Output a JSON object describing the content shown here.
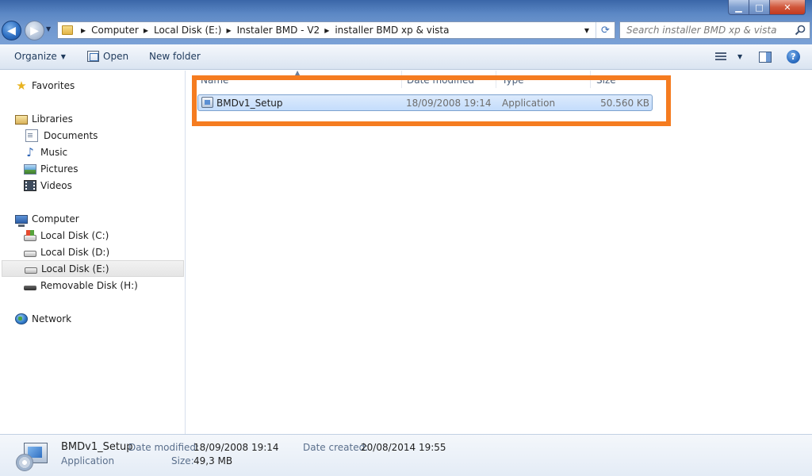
{
  "window": {
    "minimize_glyph": "▁",
    "maximize_glyph": "□",
    "close_glyph": "✕"
  },
  "address": {
    "crumbs": [
      "Computer",
      "Local Disk (E:)",
      "Instaler BMD - V2",
      "installer BMD xp & vista"
    ]
  },
  "search": {
    "placeholder": "Search installer BMD xp & vista"
  },
  "toolbar": {
    "organize_label": "Organize",
    "open_label": "Open",
    "new_folder_label": "New folder",
    "help_glyph": "?"
  },
  "nav": {
    "favorites": "Favorites",
    "libraries": "Libraries",
    "documents": "Documents",
    "music": "Music",
    "pictures": "Pictures",
    "videos": "Videos",
    "computer": "Computer",
    "disk_c": "Local Disk (C:)",
    "disk_d": "Local Disk (D:)",
    "disk_e": "Local Disk (E:)",
    "disk_h": "Removable Disk (H:)",
    "network": "Network"
  },
  "columns": {
    "name": "Name",
    "date_modified": "Date modified",
    "type": "Type",
    "size": "Size"
  },
  "files": [
    {
      "name": "BMDv1_Setup",
      "date_modified": "18/09/2008 19:14",
      "type": "Application",
      "size": "50.560 KB"
    }
  ],
  "details": {
    "name": "BMDv1_Setup",
    "type": "Application",
    "date_modified_label": "Date modified:",
    "date_modified_value": "18/09/2008 19:14",
    "size_label": "Size:",
    "size_value": "49,3 MB",
    "date_created_label": "Date created:",
    "date_created_value": "20/08/2014 19:55"
  },
  "colors": {
    "highlight_box": "#f57c20",
    "selection": "#c4ddfc"
  }
}
